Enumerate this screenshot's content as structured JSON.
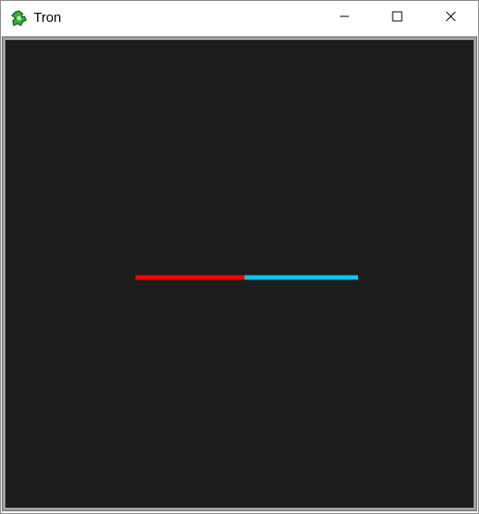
{
  "window": {
    "title": "Tron",
    "icon": "tron-app-icon"
  },
  "controls": {
    "minimize_icon": "minimize-icon",
    "maximize_icon": "maximize-icon",
    "close_icon": "close-icon"
  },
  "game": {
    "background_color": "#1c1c1c",
    "players": [
      {
        "color": "#ff0000"
      },
      {
        "color": "#00c8f0"
      }
    ]
  }
}
